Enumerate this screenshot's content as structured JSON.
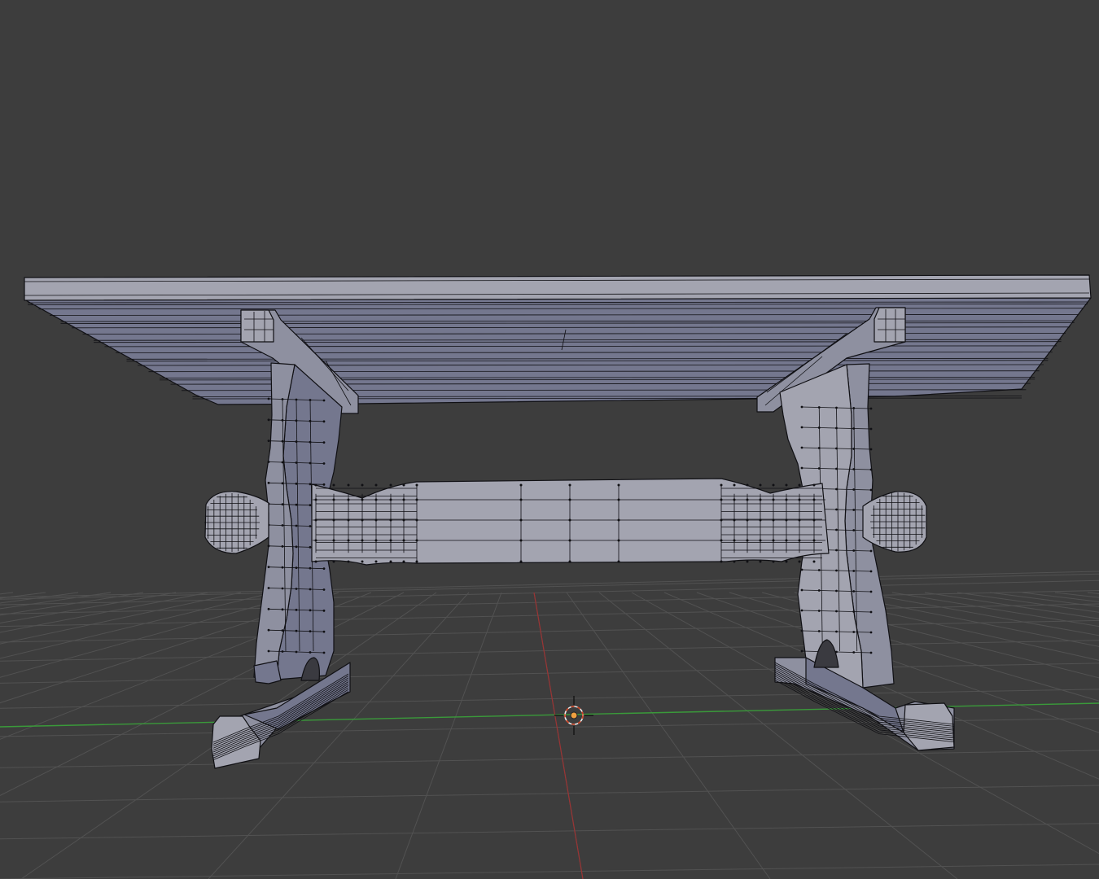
{
  "viewport": {
    "background": "#3d3d3d",
    "grid_color": "#525252",
    "x_axis_color": "#3a9a3a",
    "y_axis_color": "#9a3434",
    "mesh_face_color": "#8e90a0",
    "mesh_shadow_color": "#74778e",
    "mesh_highlight_color": "#a3a4b0",
    "wire_color": "#101014",
    "cursor_ring_color": "#e8e8e8",
    "cursor_dash_color": "#d04020",
    "origin_color": "#f0a040"
  },
  "scene": {
    "object": "table-mesh",
    "mode": "edit-mode",
    "icons": [
      "3d-cursor-icon",
      "origin-icon"
    ]
  }
}
